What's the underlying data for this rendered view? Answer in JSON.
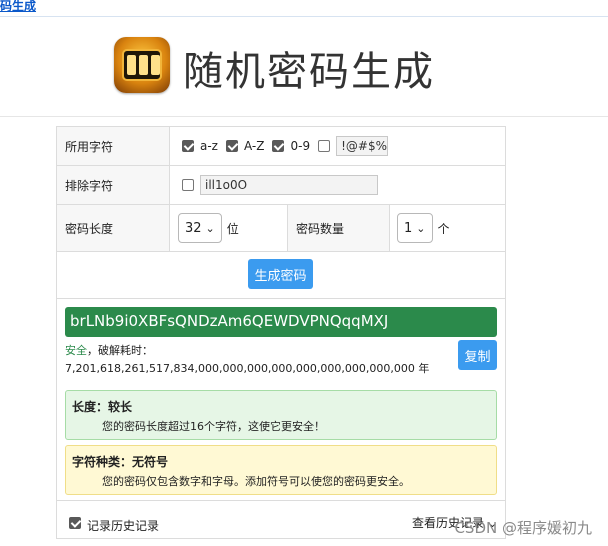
{
  "topbar": {
    "link": "码生成"
  },
  "header": {
    "title": "随机密码生成"
  },
  "rows": {
    "chars": {
      "label": "所用字符",
      "options": [
        {
          "label": "a-z",
          "checked": true
        },
        {
          "label": "A-Z",
          "checked": true
        },
        {
          "label": "0-9",
          "checked": true
        },
        {
          "label": "",
          "checked": false
        }
      ],
      "symbols_value": "!@#$%"
    },
    "exclude": {
      "label": "排除字符",
      "checked": false,
      "value": "ill1o0O"
    },
    "length": {
      "label": "密码长度",
      "value": "32",
      "unit": "位"
    },
    "count": {
      "label": "密码数量",
      "value": "1",
      "unit": "个"
    }
  },
  "generate_button": "生成密码",
  "result": {
    "password": "brLNb9i0XBFsQNDzAm6QEWDVPNQqqMXJ",
    "safety": "安全",
    "crack_label": "，破解耗时：",
    "crack_time": "7,201,618,261,517,834,000,000,000,000,000,000,000,000,000 年",
    "copy_button": "复制"
  },
  "alerts": [
    {
      "title": "长度：较长",
      "body": "您的密码长度超过16个字符，这使它更安全！"
    },
    {
      "title": "字符种类：无符号",
      "body": "您的密码仅包含数字和字母。添加符号可以使您的密码更安全。"
    }
  ],
  "footer": {
    "history_checkbox_label": "记录历史记录",
    "history_checked": true,
    "view_history": "查看历史记录"
  },
  "watermark": "CSDN @程序媛初九"
}
